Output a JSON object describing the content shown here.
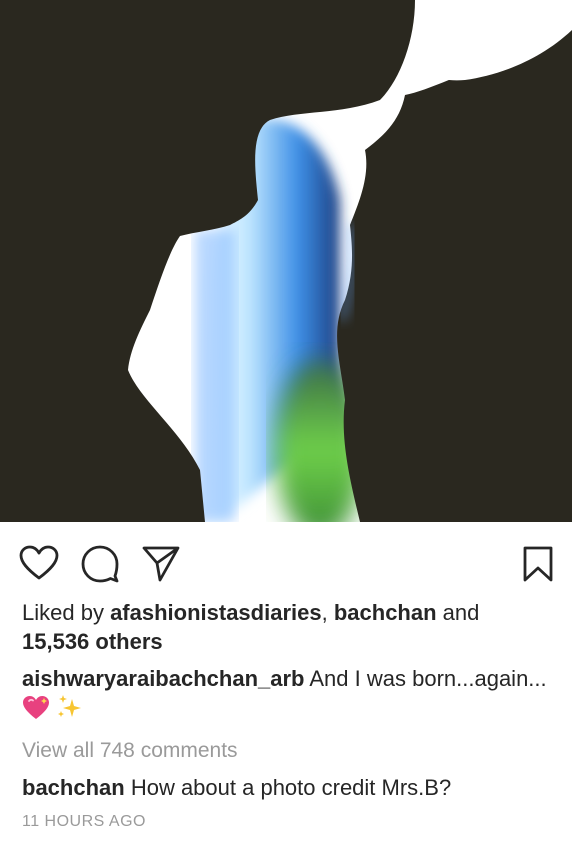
{
  "post": {
    "liked_by_prefix": "Liked by ",
    "liked_by_user1": "afashionistasdiaries",
    "liked_by_sep": ", ",
    "liked_by_user2": "bachchan",
    "liked_by_and": " and",
    "liked_by_others": "15,536 others",
    "caption_user": "aishwaryaraibachchan_arb",
    "caption_text": " And I was born...again...",
    "view_all_comments": "View all 748 comments",
    "comment_user": "bachchan",
    "comment_text": " How about a photo credit Mrs.B?",
    "timestamp": "11 HOURS AGO"
  },
  "icons": {
    "like": "heart-icon",
    "comment": "speech-bubble-icon",
    "share": "paper-plane-icon",
    "save": "bookmark-icon",
    "caption_emojis": [
      "sparkling-heart-icon",
      "sparkles-icon"
    ]
  },
  "colors": {
    "text": "#262626",
    "secondary_text": "#9a9a9a",
    "background": "#ffffff"
  }
}
